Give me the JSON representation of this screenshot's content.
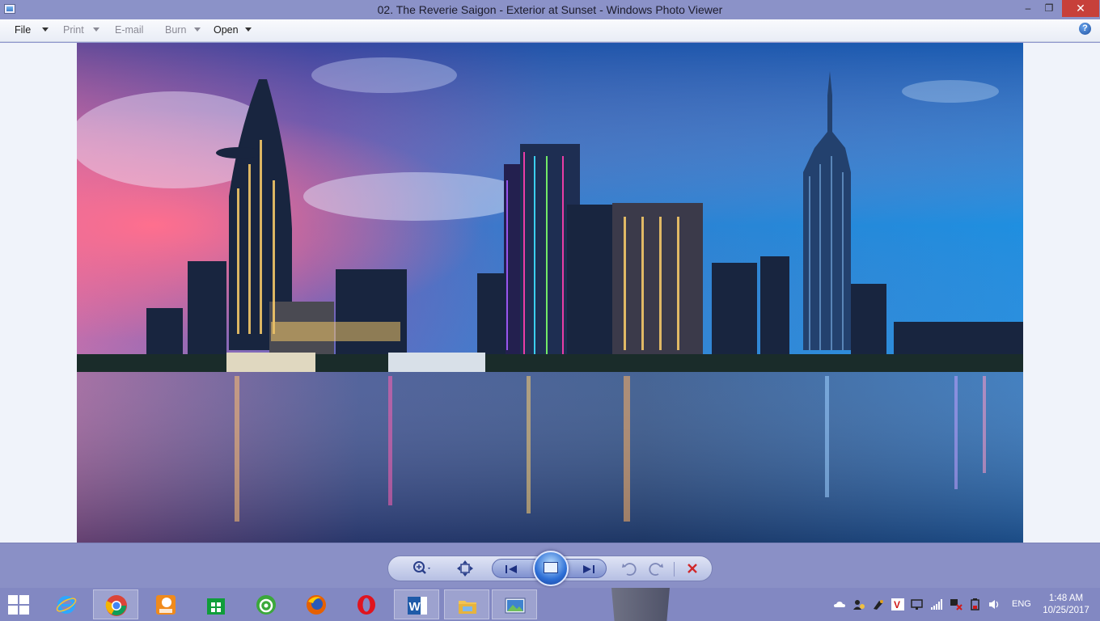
{
  "window": {
    "title": "02. The Reverie Saigon - Exterior at Sunset - Windows Photo Viewer",
    "app_icon": "photo-viewer-icon",
    "controls": {
      "minimize": "–",
      "maximize": "❐",
      "close": "✕"
    }
  },
  "menubar": {
    "items": [
      {
        "label": "File",
        "enabled": true,
        "has_dropdown": true
      },
      {
        "label": "Print",
        "enabled": false,
        "has_dropdown": true
      },
      {
        "label": "E-mail",
        "enabled": false,
        "has_dropdown": false
      },
      {
        "label": "Burn",
        "enabled": false,
        "has_dropdown": true
      },
      {
        "label": "Open",
        "enabled": true,
        "has_dropdown": true
      }
    ],
    "help_label": "?"
  },
  "photo": {
    "subject": "city-skyline-at-sunset-over-river"
  },
  "controls": {
    "zoom_icon": "zoom-icon",
    "actual_size_icon": "actual-size-icon",
    "previous_icon": "previous-icon",
    "slideshow_icon": "slideshow-icon",
    "next_icon": "next-icon",
    "rotate_ccw_icon": "rotate-counterclockwise-icon",
    "rotate_cw_icon": "rotate-clockwise-icon",
    "delete_icon": "delete-icon"
  },
  "taskbar": {
    "apps": [
      {
        "name": "internet-explorer",
        "active": false
      },
      {
        "name": "google-chrome",
        "active": true
      },
      {
        "name": "foxit-pdf",
        "active": false
      },
      {
        "name": "windows-store",
        "active": false
      },
      {
        "name": "coc-coc-browser",
        "active": false
      },
      {
        "name": "firefox",
        "active": false
      },
      {
        "name": "opera",
        "active": false
      },
      {
        "name": "microsoft-word",
        "active": true
      },
      {
        "name": "file-explorer",
        "active": true
      },
      {
        "name": "photo-viewer",
        "active": true
      }
    ],
    "tray": {
      "language": "ENG",
      "time": "1:48 AM",
      "date": "10/25/2017"
    }
  },
  "colors": {
    "titlebar": "#8b92c8",
    "close_button": "#c7403a",
    "taskbar": "#8288c2",
    "delete_red": "#d0282a"
  }
}
